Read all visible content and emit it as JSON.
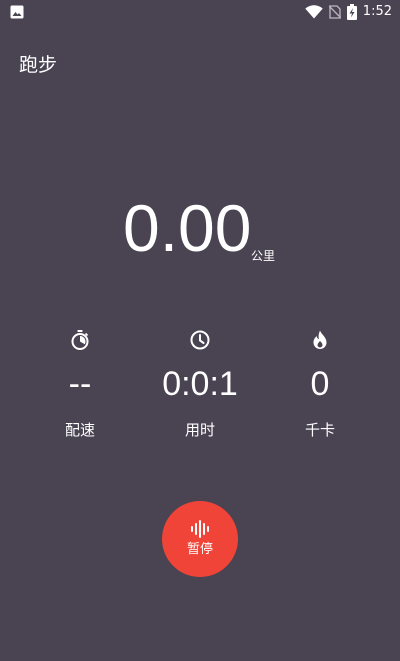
{
  "status_bar": {
    "time": "1:52",
    "icons": [
      "image-notification-icon",
      "wifi-icon",
      "no-sim-icon",
      "battery-charging-icon"
    ]
  },
  "app": {
    "title": "跑步"
  },
  "distance": {
    "value": "0.00",
    "unit": "公里"
  },
  "stats": [
    {
      "icon": "stopwatch-icon",
      "value": "--",
      "label": "配速"
    },
    {
      "icon": "clock-icon",
      "value": "0:0:1",
      "label": "用时"
    },
    {
      "icon": "flame-icon",
      "value": "0",
      "label": "千卡"
    }
  ],
  "pause_button": {
    "icon": "voice-wave-icon",
    "label": "暂停"
  },
  "colors": {
    "background": "#4a4352",
    "accent": "#f04438",
    "text": "#ffffff"
  }
}
